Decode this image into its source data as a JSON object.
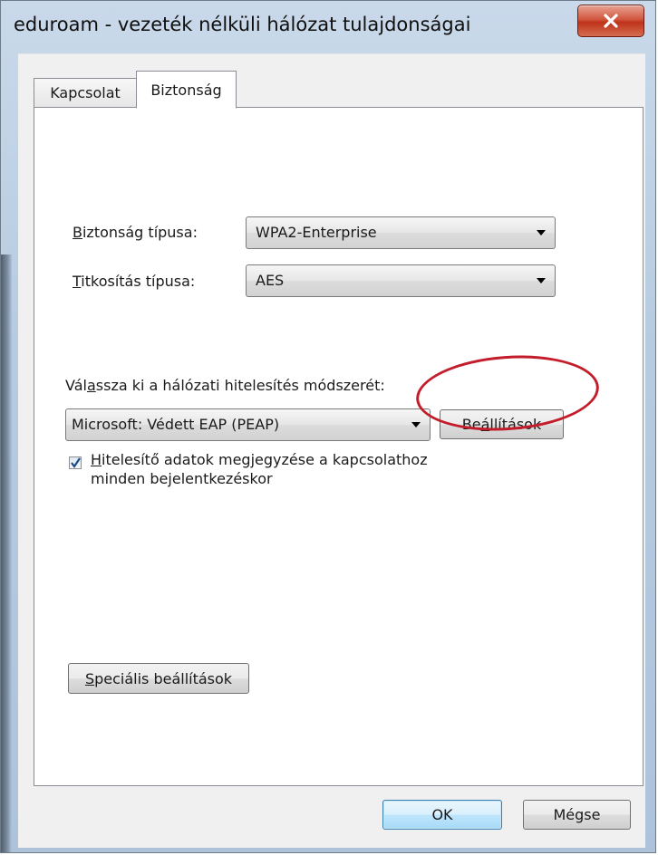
{
  "window": {
    "title": "eduroam - vezeték nélküli hálózat tulajdonságai",
    "close_icon": "close-icon"
  },
  "tabs": [
    {
      "label": "Kapcsolat",
      "selected": false
    },
    {
      "label": "Biztonság",
      "selected": true
    }
  ],
  "security": {
    "type_label_first": "B",
    "type_label_rest": "iztonság típusa:",
    "type_value": "WPA2-Enterprise",
    "encryption_label_first": "T",
    "encryption_label_rest": "itkosítás típusa:",
    "encryption_value": "AES"
  },
  "auth": {
    "label_pre": "Vál",
    "label_u": "a",
    "label_post": "ssza ki a hálózati hitelesítés módszerét:",
    "method_value": "Microsoft: Védett EAP (PEAP)",
    "settings_pre": "Be",
    "settings_u": "á",
    "settings_post": "llítások",
    "remember_first": "H",
    "remember_line1_rest": "itelesítő adatok megjegyzése a kapcsolathoz",
    "remember_line2": "minden bejelentkezéskor",
    "remember_checked": true
  },
  "advanced": {
    "label_first": "S",
    "label_rest": "peciális beállítások"
  },
  "footer": {
    "ok_label": "OK",
    "cancel_label": "Mégse"
  },
  "colors": {
    "highlight_ellipse": "#c31d2b",
    "close_button": "#c9472e",
    "ok_border": "#3c7fb1"
  }
}
